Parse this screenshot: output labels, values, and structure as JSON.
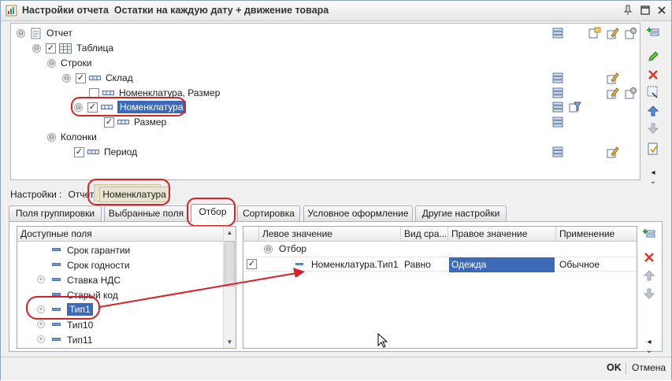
{
  "window": {
    "title": "Настройки отчета  Остатки на каждую дату + движение товара",
    "pin_icon": "pin-icon",
    "maximize_icon": "maximize-icon",
    "close_icon": "close-icon"
  },
  "tree": {
    "rows": [
      {
        "label": "Отчет",
        "level": 0,
        "expander": "⊖",
        "checkbox": false,
        "icon": "report-icon"
      },
      {
        "label": "Таблица",
        "level": 1,
        "expander": "⊖",
        "checkbox": true,
        "checked": true,
        "icon": "table-icon"
      },
      {
        "label": "Строки",
        "level": 2,
        "expander": "⊖",
        "checkbox": false,
        "icon": ""
      },
      {
        "label": "Склад",
        "level": 3,
        "expander": "⊖",
        "checkbox": true,
        "checked": true,
        "icon": "grouping-icon"
      },
      {
        "label": "Номенклатура, Размер",
        "level": 4,
        "expander": "",
        "checkbox": true,
        "checked": false,
        "icon": "grouping-icon"
      },
      {
        "label": "Номенклатура",
        "level": 3,
        "expander": "⊖",
        "checkbox": true,
        "checked": true,
        "icon": "grouping-icon",
        "selected": true
      },
      {
        "label": "Размер",
        "level": 4,
        "expander": "",
        "checkbox": true,
        "checked": true,
        "icon": "grouping-icon"
      },
      {
        "label": "Колонки",
        "level": 2,
        "expander": "⊖",
        "checkbox": false,
        "icon": ""
      },
      {
        "label": "Период",
        "level": 3,
        "expander": "",
        "checkbox": true,
        "checked": true,
        "icon": "grouping-icon"
      }
    ]
  },
  "side_toolbar_top": [
    "add-icon",
    "edit-icon",
    "delete-icon",
    "edit-selection-icon",
    "move-up-icon",
    "move-down-icon",
    "report-settings-icon",
    "more-icon"
  ],
  "settings_line": {
    "label": "Настройки :",
    "path_part": "Отчет",
    "current": "Номенклатура"
  },
  "tabs": [
    "Поля группировки",
    "Выбранные поля",
    "Отбор",
    "Сортировка",
    "Условное оформление",
    "Другие настройки"
  ],
  "available_fields": {
    "header": "Доступные поля",
    "items": [
      {
        "label": "Срок гарантии",
        "expandable": false
      },
      {
        "label": "Срок годности",
        "expandable": false
      },
      {
        "label": "Ставка НДС",
        "expandable": true
      },
      {
        "label": "Старый код",
        "expandable": false
      },
      {
        "label": "Тип1",
        "expandable": true,
        "selected": true
      },
      {
        "label": "Тип10",
        "expandable": true
      },
      {
        "label": "Тип11",
        "expandable": true
      }
    ]
  },
  "filter_grid": {
    "columns": [
      "Левое значение",
      "Вид сра...",
      "Правое значение",
      "Применение"
    ],
    "group_label": "Отбор",
    "rows": [
      {
        "checked": true,
        "left": "Номенклатура.Тип1",
        "comparison": "Равно",
        "right": "Одежда",
        "usage": "Обычное"
      }
    ]
  },
  "side_toolbar_bottom": [
    "add-icon",
    "delete-icon",
    "move-up-icon",
    "move-down-icon",
    "more-icon"
  ],
  "footer": {
    "ok": "OK",
    "cancel": "Отмена"
  },
  "colors": {
    "highlight_annotation": "#d6212a",
    "selection": "#3d6ab8"
  }
}
